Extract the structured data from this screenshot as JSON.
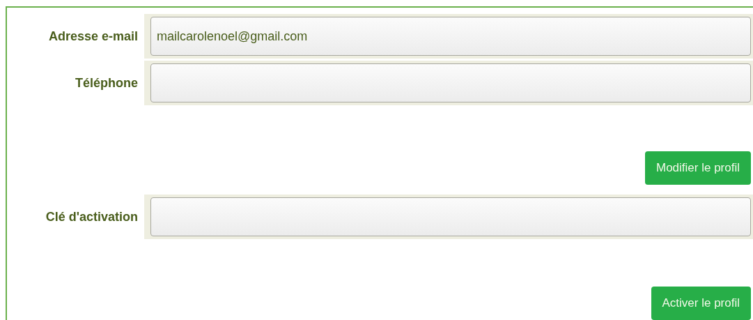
{
  "sections": [
    {
      "fields": [
        {
          "label": "Adresse e-mail",
          "value": "mailcarolenoel@gmail.com"
        },
        {
          "label": "Téléphone"
        }
      ],
      "button": "Modifier le profil"
    },
    {
      "fields": [
        {
          "label": "Clé d'activation"
        }
      ],
      "button": "Activer le profil"
    }
  ]
}
